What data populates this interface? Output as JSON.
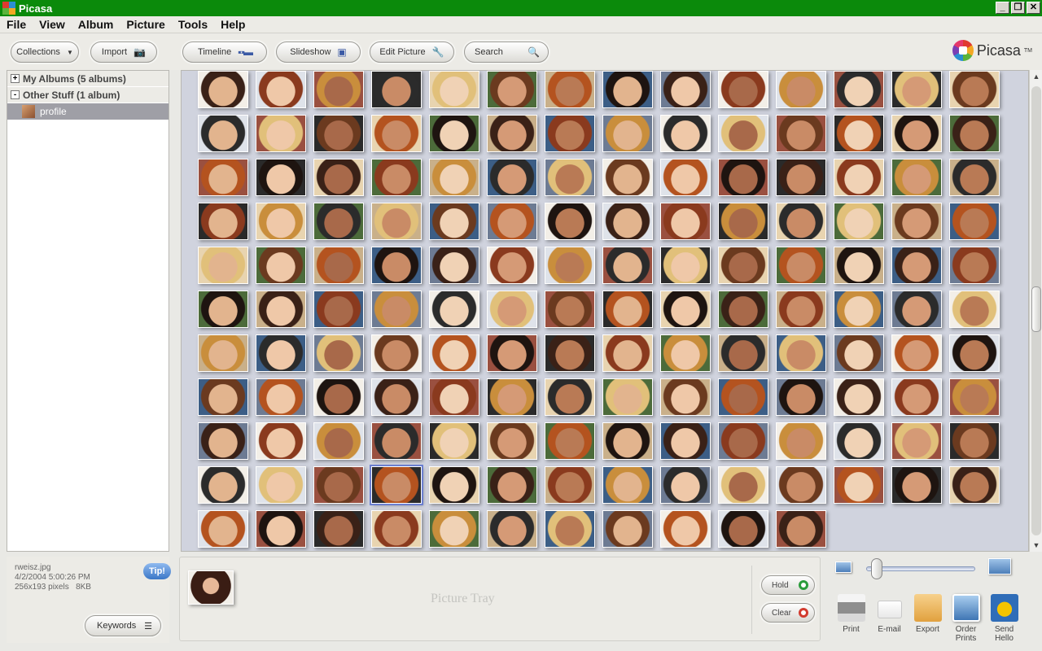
{
  "window": {
    "title": "Picasa",
    "controls": [
      "_",
      "❐",
      "✕"
    ]
  },
  "menu": [
    "File",
    "View",
    "Album",
    "Picture",
    "Tools",
    "Help"
  ],
  "toolbar": {
    "collections": "Collections",
    "import": "Import",
    "timeline": "Timeline",
    "slideshow": "Slideshow",
    "edit_picture": "Edit Picture",
    "search": "Search",
    "logo_text": "Picasa",
    "logo_tm": "TM"
  },
  "folders": {
    "my_albums": "My Albums (5 albums)",
    "other_stuff": "Other Stuff (1 album)",
    "selected_album": "profile",
    "expander_plus": "+",
    "expander_minus": "-"
  },
  "info": {
    "filename": "rweisz.jpg",
    "date": "4/2/2004 5:00:26 PM",
    "dims": "256x193 pixels",
    "size": "8KB",
    "tip": "Tip!",
    "keywords": "Keywords"
  },
  "tray": {
    "label": "Picture Tray",
    "hold": "Hold",
    "clear": "Clear"
  },
  "zoom": {
    "level": 0.05
  },
  "actions": [
    "Print",
    "E-mail",
    "Export",
    "Order Prints",
    "Send Hello"
  ],
  "colors": {
    "titlebar": "#0b8a0b",
    "grid_bg": "#d0d3de",
    "selected_album": "#9f9fa6",
    "hold_dot": "#2a9c3b",
    "clear_dot": "#d23b2f"
  }
}
